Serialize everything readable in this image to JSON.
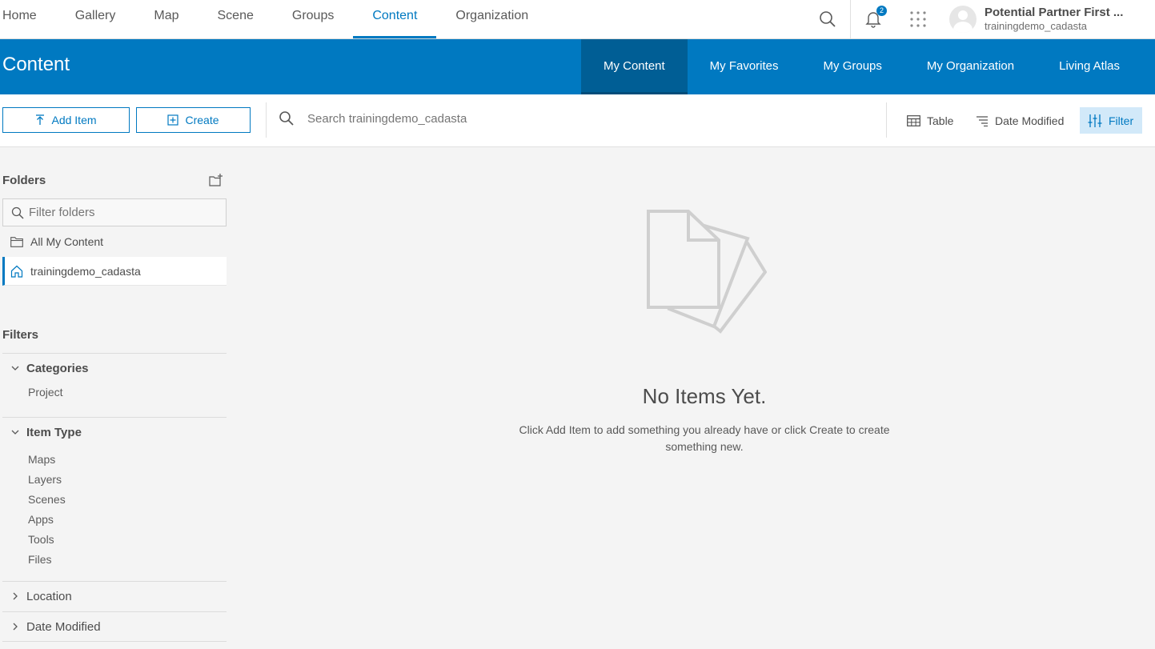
{
  "topnav": {
    "tabs": [
      "Home",
      "Gallery",
      "Map",
      "Scene",
      "Groups",
      "Content",
      "Organization"
    ],
    "active_tab": "Content",
    "notification_count": "2",
    "user_name": "Potential Partner First ...",
    "user_handle": "trainingdemo_cadasta"
  },
  "banner": {
    "title": "Content",
    "tabs": [
      "My Content",
      "My Favorites",
      "My Groups",
      "My Organization",
      "Living Atlas"
    ],
    "active_tab": "My Content"
  },
  "toolbar": {
    "add_item": "Add Item",
    "create": "Create",
    "search_placeholder": "Search trainingdemo_cadasta",
    "view": "Table",
    "sort": "Date Modified",
    "filter": "Filter"
  },
  "sidebar": {
    "folders_title": "Folders",
    "filter_placeholder": "Filter folders",
    "folders": [
      "All My Content",
      "trainingdemo_cadasta"
    ],
    "active_folder": "trainingdemo_cadasta",
    "filters_title": "Filters",
    "groups": [
      {
        "label": "Categories",
        "expanded": true,
        "items": [
          "Project"
        ]
      },
      {
        "label": "Item Type",
        "expanded": true,
        "items": [
          "Maps",
          "Layers",
          "Scenes",
          "Apps",
          "Tools",
          "Files"
        ]
      },
      {
        "label": "Location",
        "expanded": false,
        "items": []
      },
      {
        "label": "Date Modified",
        "expanded": false,
        "items": []
      }
    ]
  },
  "empty_state": {
    "title": "No Items Yet.",
    "message": "Click Add Item to add something you already have or click Create to create something new."
  },
  "colors": {
    "accent": "#0079c1",
    "banner_active": "#005e95",
    "background": "#f4f4f4"
  }
}
